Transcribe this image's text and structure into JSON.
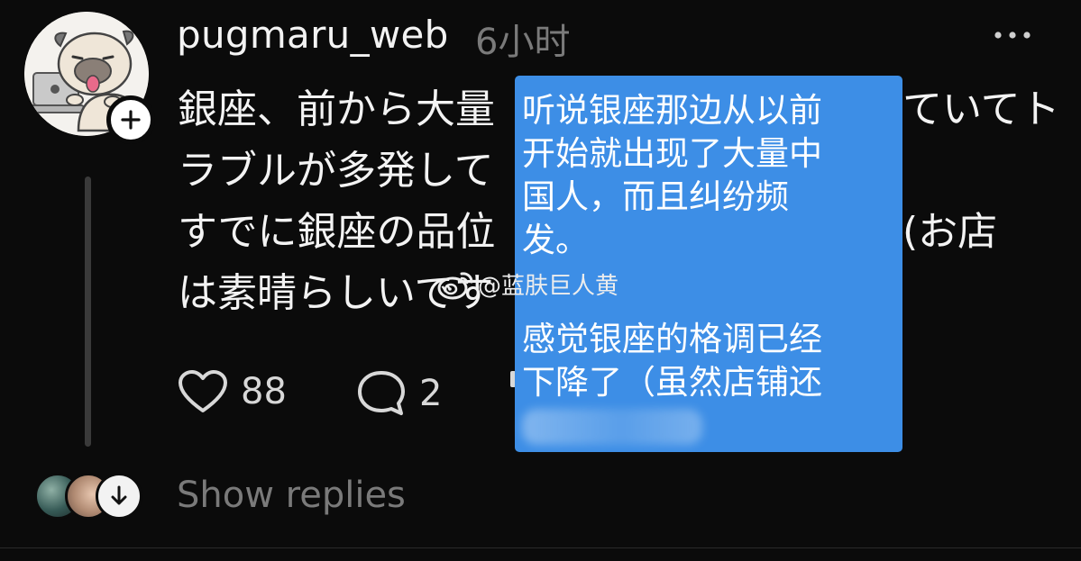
{
  "post": {
    "username": "pugmaru_web",
    "timestamp": "6小时",
    "lines": [
      "銀座、前から大量",
      "ラブルが多発して",
      "すでに銀座の品位",
      "は素晴らしいです"
    ],
    "right_fragments": [
      "ていてト",
      "",
      "(お店",
      ""
    ],
    "likes": "88",
    "replies": "2"
  },
  "watermark": {
    "handle": "@蓝肤巨人黄"
  },
  "translation": {
    "lines": [
      "听说银座那边从以前",
      "开始就出现了大量中",
      "国人，而且纠纷频",
      "发。"
    ],
    "lines2": [
      "感觉银座的格调已经",
      "下降了（虽然店铺还"
    ]
  },
  "footer": {
    "show_replies": "Show replies"
  },
  "colors": {
    "background": "#0b0b0b",
    "card": "#3d8ee6",
    "muted_text": "#7a7a7a"
  }
}
